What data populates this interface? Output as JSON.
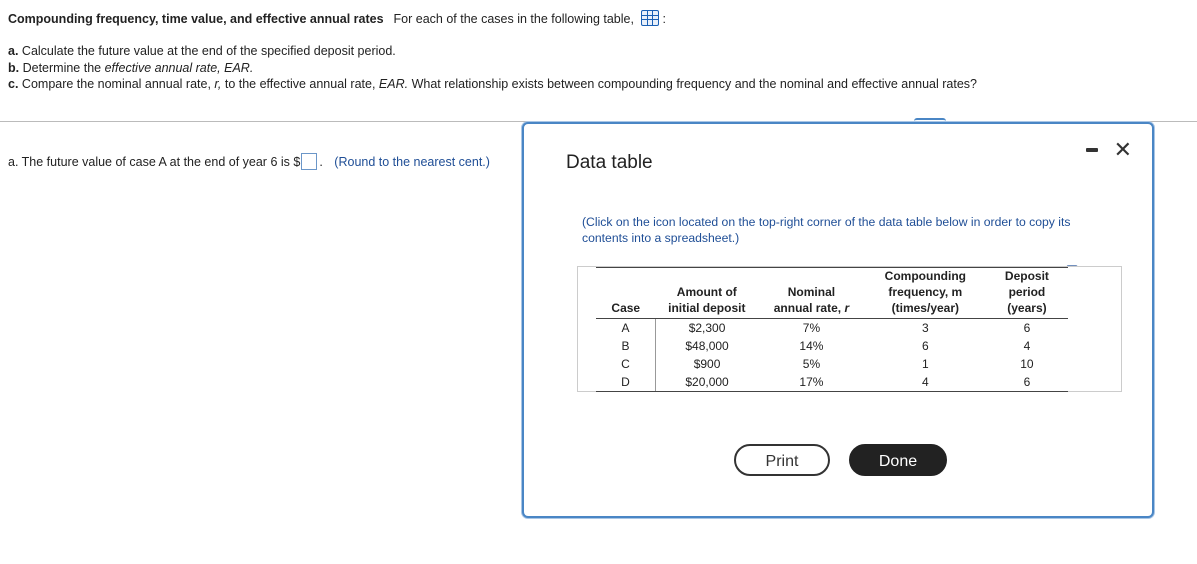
{
  "header": {
    "title": "Compounding frequency, time value, and effective annual rates",
    "intro": "For each of the cases in the following table,",
    "table_icon": "table-grid-icon",
    "colon": ":"
  },
  "questions": {
    "a_label": "a.",
    "a_text": "Calculate the future value at the end of the specified deposit period.",
    "b_label": "b.",
    "b_text_plain": "Determine the",
    "b_text_italic": "effective annual rate, EAR.",
    "c_label": "c.",
    "c_text_1": "Compare the nominal annual rate,",
    "c_r": "r,",
    "c_text_2": "to the effective annual rate,",
    "c_ear": "EAR.",
    "c_text_3": "What relationship exists between compounding frequency and the nominal and effective annual rates?"
  },
  "answer": {
    "prefix": "a.  The future value of case A at the end of year 6 is $",
    "value": "",
    "suffix": ".",
    "note": "(Round to the nearest cent.)"
  },
  "modal": {
    "title": "Data table",
    "minimize_icon": "minimize-icon",
    "close_symbol": "✕",
    "instructions": "(Click on the icon located on the top-right corner of the data table below in order to copy its contents into a spreadsheet.)",
    "copy_icon": "copy-icon",
    "table": {
      "headers": {
        "case": "Case",
        "amount_1": "Amount of",
        "amount_2": "initial deposit",
        "nominal_1": "Nominal",
        "nominal_2": "annual rate,",
        "nominal_r": "r",
        "comp_1": "Compounding",
        "comp_2": "frequency, m",
        "comp_3": "(times/year)",
        "dep_1": "Deposit",
        "dep_2": "period",
        "dep_3": "(years)"
      },
      "rows": [
        {
          "case": "A",
          "amount": "$2,300",
          "rate": "7%",
          "freq": "3",
          "period": "6"
        },
        {
          "case": "B",
          "amount": "$48,000",
          "rate": "14%",
          "freq": "6",
          "period": "4"
        },
        {
          "case": "C",
          "amount": "$900",
          "rate": "5%",
          "freq": "1",
          "period": "10"
        },
        {
          "case": "D",
          "amount": "$20,000",
          "rate": "17%",
          "freq": "4",
          "period": "6"
        }
      ]
    },
    "print_label": "Print",
    "done_label": "Done"
  },
  "colors": {
    "accent_blue": "#1f4e96",
    "modal_border": "#4a86c5",
    "done_bg": "#222222"
  }
}
